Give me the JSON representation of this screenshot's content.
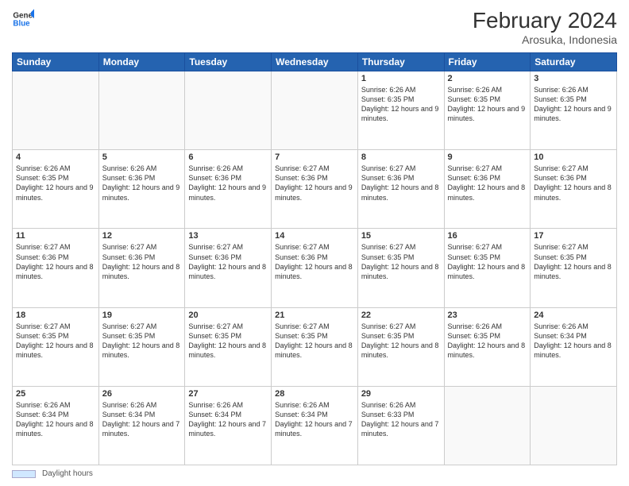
{
  "header": {
    "logo_line1": "General",
    "logo_line2": "Blue",
    "month": "February 2024",
    "location": "Arosuka, Indonesia"
  },
  "weekdays": [
    "Sunday",
    "Monday",
    "Tuesday",
    "Wednesday",
    "Thursday",
    "Friday",
    "Saturday"
  ],
  "footer": {
    "swatch_label": "Daylight hours"
  },
  "weeks": [
    [
      {
        "day": "",
        "info": ""
      },
      {
        "day": "",
        "info": ""
      },
      {
        "day": "",
        "info": ""
      },
      {
        "day": "",
        "info": ""
      },
      {
        "day": "1",
        "info": "Sunrise: 6:26 AM\nSunset: 6:35 PM\nDaylight: 12 hours and 9 minutes."
      },
      {
        "day": "2",
        "info": "Sunrise: 6:26 AM\nSunset: 6:35 PM\nDaylight: 12 hours and 9 minutes."
      },
      {
        "day": "3",
        "info": "Sunrise: 6:26 AM\nSunset: 6:35 PM\nDaylight: 12 hours and 9 minutes."
      }
    ],
    [
      {
        "day": "4",
        "info": "Sunrise: 6:26 AM\nSunset: 6:35 PM\nDaylight: 12 hours and 9 minutes."
      },
      {
        "day": "5",
        "info": "Sunrise: 6:26 AM\nSunset: 6:36 PM\nDaylight: 12 hours and 9 minutes."
      },
      {
        "day": "6",
        "info": "Sunrise: 6:26 AM\nSunset: 6:36 PM\nDaylight: 12 hours and 9 minutes."
      },
      {
        "day": "7",
        "info": "Sunrise: 6:27 AM\nSunset: 6:36 PM\nDaylight: 12 hours and 9 minutes."
      },
      {
        "day": "8",
        "info": "Sunrise: 6:27 AM\nSunset: 6:36 PM\nDaylight: 12 hours and 8 minutes."
      },
      {
        "day": "9",
        "info": "Sunrise: 6:27 AM\nSunset: 6:36 PM\nDaylight: 12 hours and 8 minutes."
      },
      {
        "day": "10",
        "info": "Sunrise: 6:27 AM\nSunset: 6:36 PM\nDaylight: 12 hours and 8 minutes."
      }
    ],
    [
      {
        "day": "11",
        "info": "Sunrise: 6:27 AM\nSunset: 6:36 PM\nDaylight: 12 hours and 8 minutes."
      },
      {
        "day": "12",
        "info": "Sunrise: 6:27 AM\nSunset: 6:36 PM\nDaylight: 12 hours and 8 minutes."
      },
      {
        "day": "13",
        "info": "Sunrise: 6:27 AM\nSunset: 6:36 PM\nDaylight: 12 hours and 8 minutes."
      },
      {
        "day": "14",
        "info": "Sunrise: 6:27 AM\nSunset: 6:36 PM\nDaylight: 12 hours and 8 minutes."
      },
      {
        "day": "15",
        "info": "Sunrise: 6:27 AM\nSunset: 6:35 PM\nDaylight: 12 hours and 8 minutes."
      },
      {
        "day": "16",
        "info": "Sunrise: 6:27 AM\nSunset: 6:35 PM\nDaylight: 12 hours and 8 minutes."
      },
      {
        "day": "17",
        "info": "Sunrise: 6:27 AM\nSunset: 6:35 PM\nDaylight: 12 hours and 8 minutes."
      }
    ],
    [
      {
        "day": "18",
        "info": "Sunrise: 6:27 AM\nSunset: 6:35 PM\nDaylight: 12 hours and 8 minutes."
      },
      {
        "day": "19",
        "info": "Sunrise: 6:27 AM\nSunset: 6:35 PM\nDaylight: 12 hours and 8 minutes."
      },
      {
        "day": "20",
        "info": "Sunrise: 6:27 AM\nSunset: 6:35 PM\nDaylight: 12 hours and 8 minutes."
      },
      {
        "day": "21",
        "info": "Sunrise: 6:27 AM\nSunset: 6:35 PM\nDaylight: 12 hours and 8 minutes."
      },
      {
        "day": "22",
        "info": "Sunrise: 6:27 AM\nSunset: 6:35 PM\nDaylight: 12 hours and 8 minutes."
      },
      {
        "day": "23",
        "info": "Sunrise: 6:26 AM\nSunset: 6:35 PM\nDaylight: 12 hours and 8 minutes."
      },
      {
        "day": "24",
        "info": "Sunrise: 6:26 AM\nSunset: 6:34 PM\nDaylight: 12 hours and 8 minutes."
      }
    ],
    [
      {
        "day": "25",
        "info": "Sunrise: 6:26 AM\nSunset: 6:34 PM\nDaylight: 12 hours and 8 minutes."
      },
      {
        "day": "26",
        "info": "Sunrise: 6:26 AM\nSunset: 6:34 PM\nDaylight: 12 hours and 7 minutes."
      },
      {
        "day": "27",
        "info": "Sunrise: 6:26 AM\nSunset: 6:34 PM\nDaylight: 12 hours and 7 minutes."
      },
      {
        "day": "28",
        "info": "Sunrise: 6:26 AM\nSunset: 6:34 PM\nDaylight: 12 hours and 7 minutes."
      },
      {
        "day": "29",
        "info": "Sunrise: 6:26 AM\nSunset: 6:33 PM\nDaylight: 12 hours and 7 minutes."
      },
      {
        "day": "",
        "info": ""
      },
      {
        "day": "",
        "info": ""
      }
    ]
  ]
}
